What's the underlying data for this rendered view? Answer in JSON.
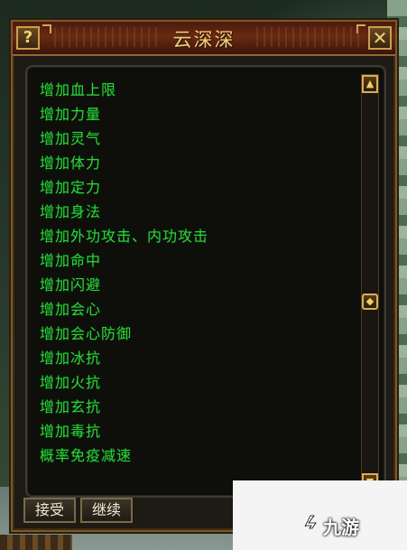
{
  "dialog": {
    "title": "云深深",
    "help_label": "?",
    "close_label": "✕"
  },
  "items": [
    "增加血上限",
    "增加力量",
    "增加灵气",
    "增加体力",
    "增加定力",
    "增加身法",
    "增加外功攻击、内功攻击",
    "增加命中",
    "增加闪避",
    "增加会心",
    "增加会心防御",
    "增加冰抗",
    "增加火抗",
    "增加玄抗",
    "增加毒抗",
    "概率免疫减速"
  ],
  "buttons": {
    "accept": "接受",
    "continue": "继续"
  },
  "scrollbar": {
    "up_icon": "▲",
    "down_icon": "▼",
    "thumb_icon": "◆",
    "position": 0.5
  },
  "watermark": {
    "text": "九游"
  },
  "colors": {
    "item_text": "#29d43a",
    "title_text": "#f0d27a",
    "frame_gold": "#d7b054"
  }
}
